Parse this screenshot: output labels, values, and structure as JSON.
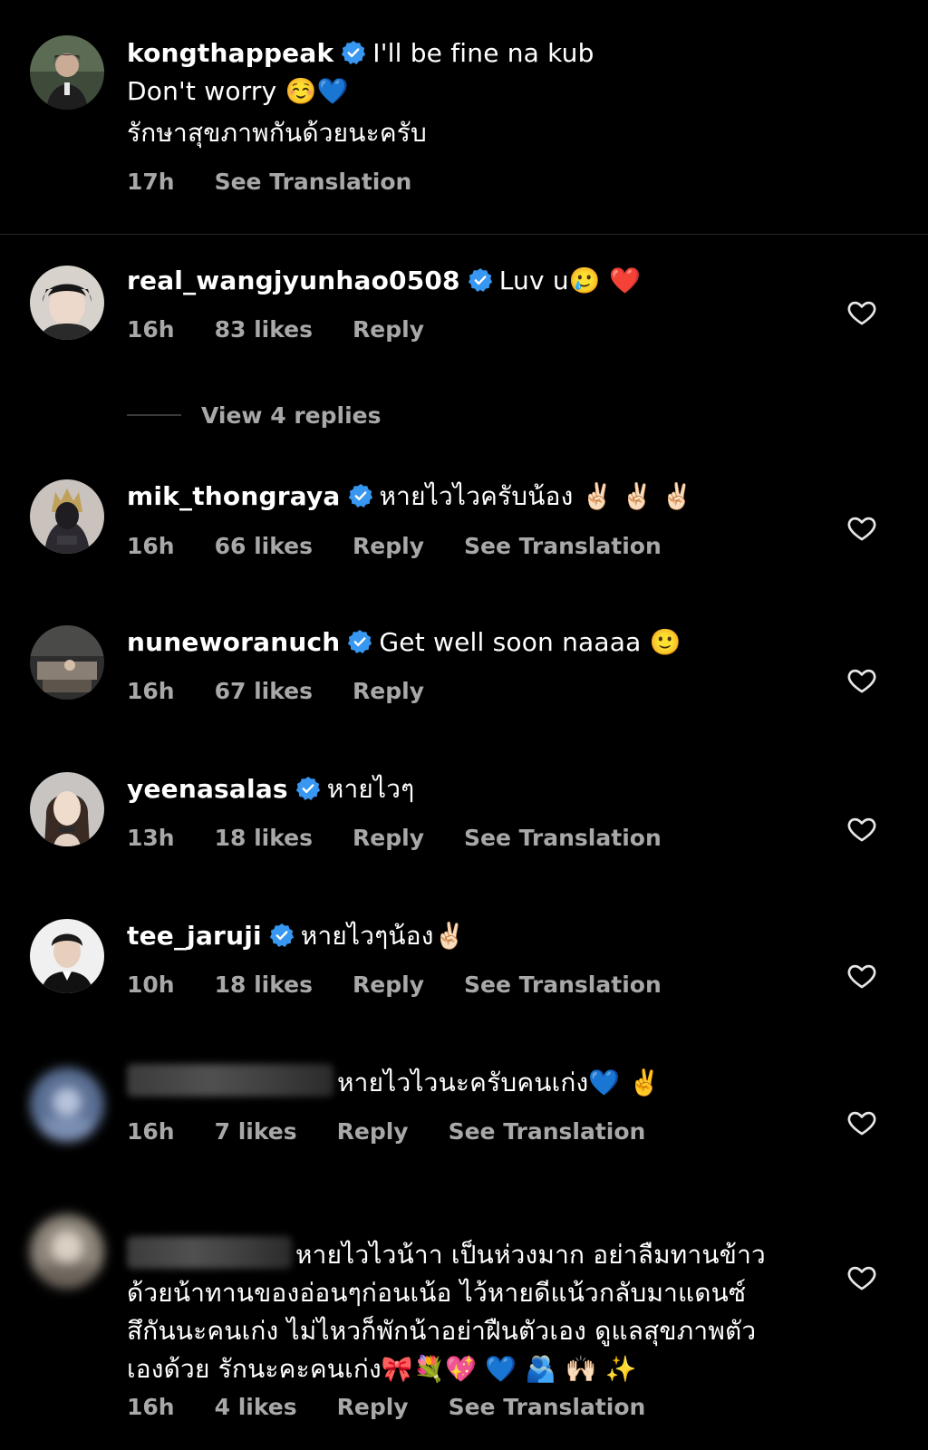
{
  "caption": {
    "username": "kongthappeak",
    "line1": "I'll be fine na kub",
    "line2": "Don't worry ☺️💙",
    "line3": "รักษาสุขภาพกันด้วยนะครับ",
    "time": "17h",
    "see_translation": "See Translation"
  },
  "comments": [
    {
      "username": "real_wangjyunhao0508",
      "text": "Luv u🥲 ❤️",
      "time": "16h",
      "likes": "83 likes",
      "reply": "Reply",
      "view_replies": "View 4 replies"
    },
    {
      "username": "mik_thongraya",
      "text": "หายไวไวครับน้อง ✌🏻 ✌🏻 ✌🏻",
      "time": "16h",
      "likes": "66 likes",
      "reply": "Reply",
      "see_translation": "See Translation"
    },
    {
      "username": "nuneworanuch",
      "text": "Get well soon naaaa 🙂",
      "time": "16h",
      "likes": "67 likes",
      "reply": "Reply"
    },
    {
      "username": "yeenasalas",
      "text": "หายไวๆ",
      "time": "13h",
      "likes": "18 likes",
      "reply": "Reply",
      "see_translation": "See Translation"
    },
    {
      "username": "tee_jaruji",
      "text": "หายไวๆน้อง✌🏻",
      "time": "10h",
      "likes": "18 likes",
      "reply": "Reply",
      "see_translation": "See Translation"
    },
    {
      "text": "หายไวไวนะครับคนเก่ง💙 ✌️",
      "time": "16h",
      "likes": "7 likes",
      "reply": "Reply",
      "see_translation": "See Translation"
    },
    {
      "text_line1": "หายไวไวน้าา เป็นห่วงมาก อย่าลืมทานข้าว",
      "text_line2": "ด้วยน้าทานของอ่อนๆก่อนเน้อ ไว้หายดีแน้วกลับมาแดนซ์",
      "text_line3": "สึกันนะคนเก่ง ไม่ไหวก็พักน้าอย่าฝืนตัวเอง ดูแลสุขภาพตัว",
      "text_line4": "เองด้วย รักนะคะคนเก่ง🎀💐💖 💙 🫂 🙌🏻 ✨",
      "time": "16h",
      "likes": "4 likes",
      "reply": "Reply",
      "see_translation": "See Translation"
    }
  ],
  "colors": {
    "background": "#000000",
    "text": "#ffffff",
    "meta": "#a8a8a8",
    "verified": "#3897f0",
    "divider": "#262626"
  },
  "icons": [
    "verified-badge-icon",
    "heart-outline-icon"
  ]
}
